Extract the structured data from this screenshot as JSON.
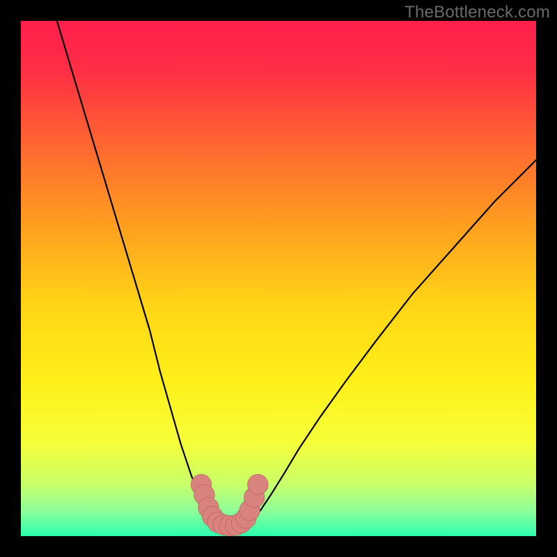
{
  "watermark": "TheBottleneck.com",
  "chart_data": {
    "type": "line",
    "title": "",
    "xlabel": "",
    "ylabel": "",
    "xlim": [
      0,
      100
    ],
    "ylim": [
      0,
      100
    ],
    "background_gradient_stops": [
      {
        "offset": 0.0,
        "color": "#ff1e4c"
      },
      {
        "offset": 0.1,
        "color": "#ff2f45"
      },
      {
        "offset": 0.25,
        "color": "#ff6a2f"
      },
      {
        "offset": 0.4,
        "color": "#ffa01f"
      },
      {
        "offset": 0.55,
        "color": "#ffd416"
      },
      {
        "offset": 0.7,
        "color": "#fff018"
      },
      {
        "offset": 0.82,
        "color": "#f5ff3a"
      },
      {
        "offset": 0.9,
        "color": "#c8ff6a"
      },
      {
        "offset": 0.95,
        "color": "#8fff98"
      },
      {
        "offset": 1.0,
        "color": "#2bffb0"
      }
    ],
    "series": [
      {
        "name": "left_curve",
        "x": [
          7,
          10,
          13,
          16,
          19,
          22,
          25,
          27,
          29,
          31,
          33,
          34.5,
          36,
          37,
          37.8
        ],
        "y": [
          100,
          90,
          80,
          70,
          60,
          50,
          40,
          32,
          25,
          18,
          12,
          8,
          5,
          3.5,
          2.8
        ]
      },
      {
        "name": "right_curve",
        "x": [
          44,
          45,
          46.5,
          48.5,
          51,
          54,
          58,
          63,
          69,
          76,
          84,
          92,
          100
        ],
        "y": [
          2.8,
          3.5,
          5,
          8,
          12,
          17,
          23,
          30,
          38,
          47,
          56,
          65,
          73
        ]
      },
      {
        "name": "valley_floor",
        "x": [
          37.8,
          39,
          40.5,
          42,
          43,
          44
        ],
        "y": [
          2.8,
          2.3,
          2.0,
          2.0,
          2.3,
          2.8
        ]
      }
    ],
    "markers": {
      "name": "highlight_points",
      "color": "#d9837e",
      "radius": 2.0,
      "points": [
        {
          "x": 35.0,
          "y": 10.0
        },
        {
          "x": 35.6,
          "y": 8.0
        },
        {
          "x": 36.4,
          "y": 5.5
        },
        {
          "x": 37.2,
          "y": 3.8
        },
        {
          "x": 38.2,
          "y": 2.7
        },
        {
          "x": 39.3,
          "y": 2.2
        },
        {
          "x": 40.5,
          "y": 2.0
        },
        {
          "x": 41.7,
          "y": 2.1
        },
        {
          "x": 42.8,
          "y": 2.6
        },
        {
          "x": 43.7,
          "y": 3.5
        },
        {
          "x": 44.4,
          "y": 5.0
        },
        {
          "x": 45.3,
          "y": 7.5
        },
        {
          "x": 46.0,
          "y": 10.0
        }
      ]
    }
  }
}
